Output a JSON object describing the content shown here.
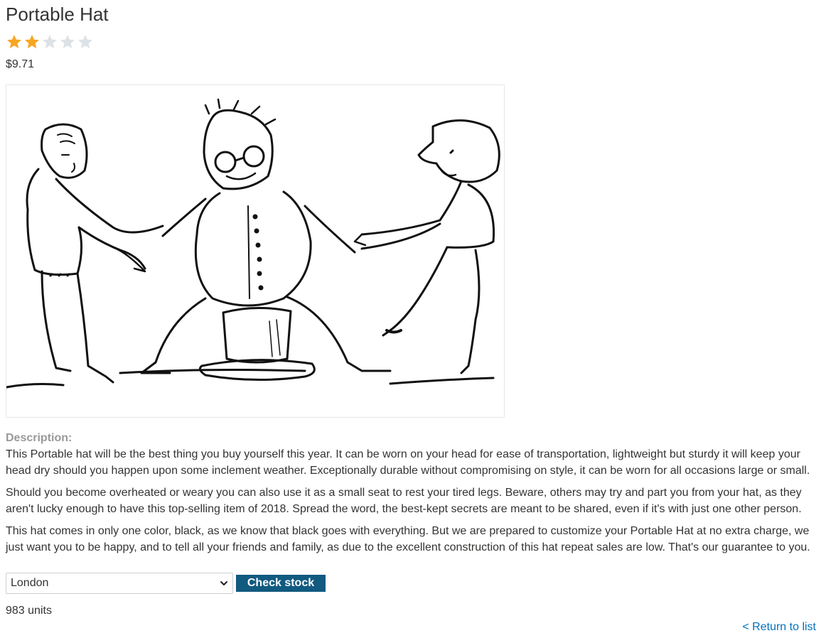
{
  "product": {
    "title": "Portable Hat",
    "rating": {
      "value": 2,
      "max": 5
    },
    "price": "$9.71",
    "image_alt": "Illustration of two people pulling a man sitting on a hat",
    "description_label": "Description:",
    "description": [
      "This Portable hat will be the best thing you buy yourself this year. It can be worn on your head for ease of transportation, lightweight but sturdy it will keep your head dry should you happen upon some inclement weather. Exceptionally durable without compromising on style, it can be worn for all occasions large or small.",
      "Should you become overheated or weary you can also use it as a small seat to rest your tired legs. Beware, others may try and part you from your hat, as they aren't lucky enough to have this top-selling item of 2018. Spread the word, the best-kept secrets are meant to be shared, even if it's with just one other person.",
      "This hat comes in only one color, black, as we know that black goes with everything. But we are prepared to customize your Portable Hat at no extra charge, we just want you to be happy, and to tell all your friends and family, as due to the excellent construction of this hat repeat sales are low. That's our guarantee to you."
    ]
  },
  "stock_check": {
    "selected_store": "London",
    "button_label": "Check stock",
    "result": "983 units"
  },
  "nav": {
    "return_label": "< Return to list"
  },
  "colors": {
    "star_filled": "#f7a623",
    "star_empty": "#dde2e6",
    "button_bg": "#115a80",
    "link": "#0071bc"
  },
  "icons": [
    "star-icon",
    "chevron-down-icon"
  ]
}
